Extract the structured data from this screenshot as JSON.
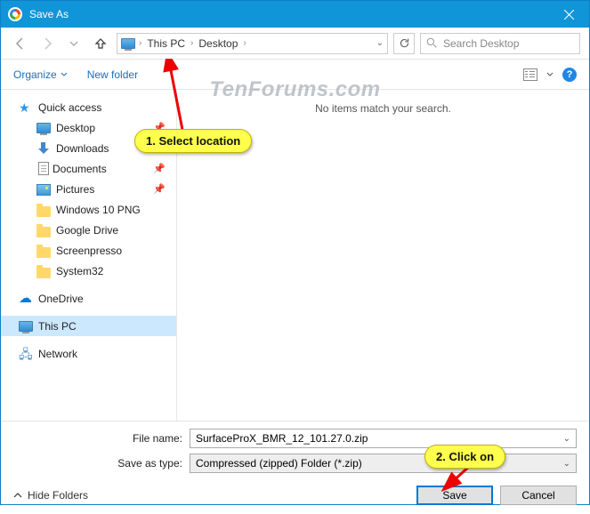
{
  "window": {
    "title": "Save As"
  },
  "nav": {
    "crumbs": [
      "This PC",
      "Desktop"
    ],
    "search_placeholder": "Search Desktop"
  },
  "toolbar": {
    "organize": "Organize",
    "new_folder": "New folder"
  },
  "tree": {
    "quick_access": "Quick access",
    "desktop": "Desktop",
    "downloads": "Downloads",
    "documents": "Documents",
    "pictures": "Pictures",
    "win10png": "Windows 10 PNG",
    "googledrive": "Google Drive",
    "screenpresso": "Screenpresso",
    "system32": "System32",
    "onedrive": "OneDrive",
    "thispc": "This PC",
    "network": "Network"
  },
  "content": {
    "empty": "No items match your search."
  },
  "footer": {
    "filename_label": "File name:",
    "filename_value": "SurfaceProX_BMR_12_101.27.0.zip",
    "type_label": "Save as type:",
    "type_value": "Compressed (zipped) Folder (*.zip)",
    "hide_folders": "Hide Folders",
    "save": "Save",
    "cancel": "Cancel"
  },
  "callouts": {
    "c1": "1. Select location",
    "c2": "2. Click on"
  },
  "watermark": "TenForums.com"
}
